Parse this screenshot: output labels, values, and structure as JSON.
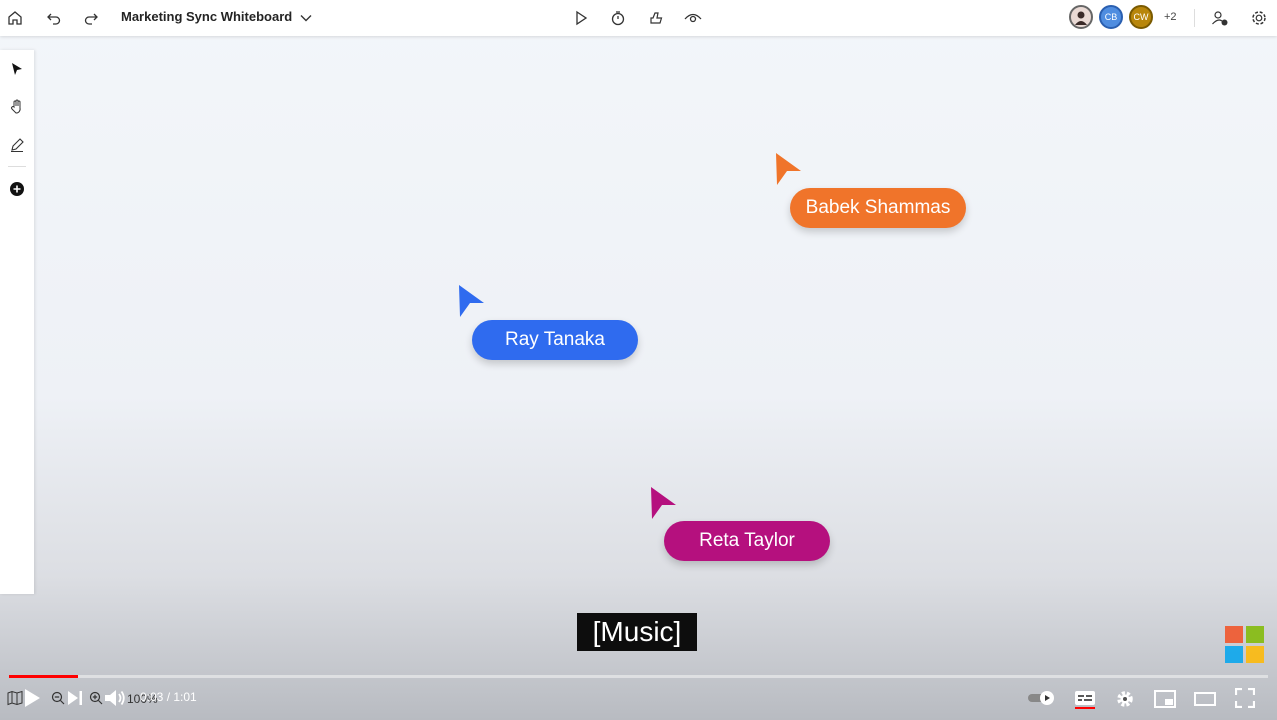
{
  "whiteboard": {
    "title": "Marketing Sync Whiteboard",
    "participants": [
      {
        "initials": "",
        "color": "#7a5a55"
      },
      {
        "initials": "CB",
        "color": "#4f8de0"
      },
      {
        "initials": "CW",
        "color": "#b8860b"
      }
    ],
    "more_participants": "+2",
    "zoom_level": "100%"
  },
  "collaborators": [
    {
      "name": "Babek Shammas",
      "color": "#f0742a"
    },
    {
      "name": "Ray Tanaka",
      "color": "#2f6bef"
    },
    {
      "name": "Reta Taylor",
      "color": "#b5107e"
    }
  ],
  "video": {
    "caption": "[Music]",
    "current_time": "0:03",
    "separator": " / ",
    "duration": "1:01",
    "progress": 0.055
  },
  "colors": {
    "progress": "#ff0000",
    "ms_red": "#f25022",
    "ms_green": "#7fba00",
    "ms_blue": "#00a4ef",
    "ms_yellow": "#ffb900"
  }
}
